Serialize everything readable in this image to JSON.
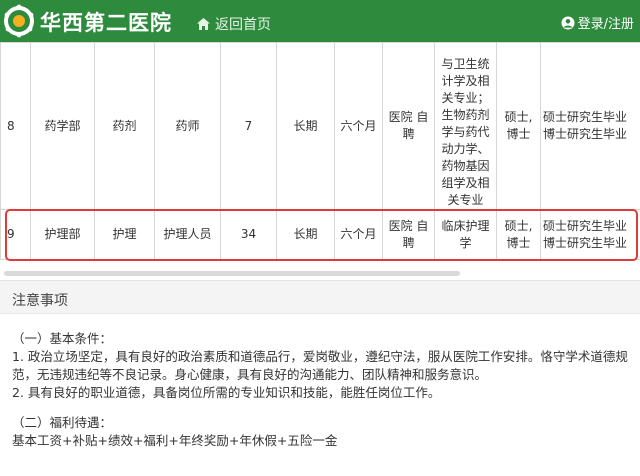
{
  "header": {
    "brand": "华西第二医院",
    "home_label": "返回首页",
    "login_label": "登录/注册",
    "colors": {
      "topbar": "#2e8b3e",
      "logo_inner": "#f2b01e"
    }
  },
  "table": {
    "rows": [
      {
        "no": "8",
        "dept": "药学部",
        "category": "药剂",
        "position": "药师",
        "count": "7",
        "term": "长期",
        "probation": "六个月",
        "employ": "医院 自聘",
        "major_lines": [
          "与卫生统",
          "计学及相",
          "关专业；",
          "生物药剂",
          "学与药代",
          "动力学、",
          "药物基因",
          "组学及相",
          "关专业"
        ],
        "degree": "硕士,博士",
        "edu_lines": [
          "硕士研究生毕业",
          "博士研究生毕业"
        ]
      },
      {
        "no": "9",
        "dept": "护理部",
        "category": "护理",
        "position": "护理人员",
        "count": "34",
        "term": "长期",
        "probation": "六个月",
        "employ": "医院 自聘",
        "major": "临床护理学",
        "degree": "硕士,博士",
        "edu_lines": [
          "硕士研究生毕业",
          "博士研究生毕业"
        ]
      }
    ]
  },
  "notice": {
    "title": "注意事项",
    "section1_title": "（一）基本条件：",
    "section1_item1": "1. 政治立场坚定，具有良好的政治素质和道德品行，爱岗敬业，遵纪守法，服从医院工作安排。恪守学术道德规范，无违规违纪等不良记录。身心健康，具有良好的沟通能力、团队精神和服务意识。",
    "section1_item2": "2. 具有良好的职业道德，具备岗位所需的专业知识和技能，能胜任岗位工作。",
    "section2_title": "（二）福利待遇：",
    "section2_text": "基本工资+补贴+绩效+福利+年终奖励+年休假+五险一金"
  }
}
